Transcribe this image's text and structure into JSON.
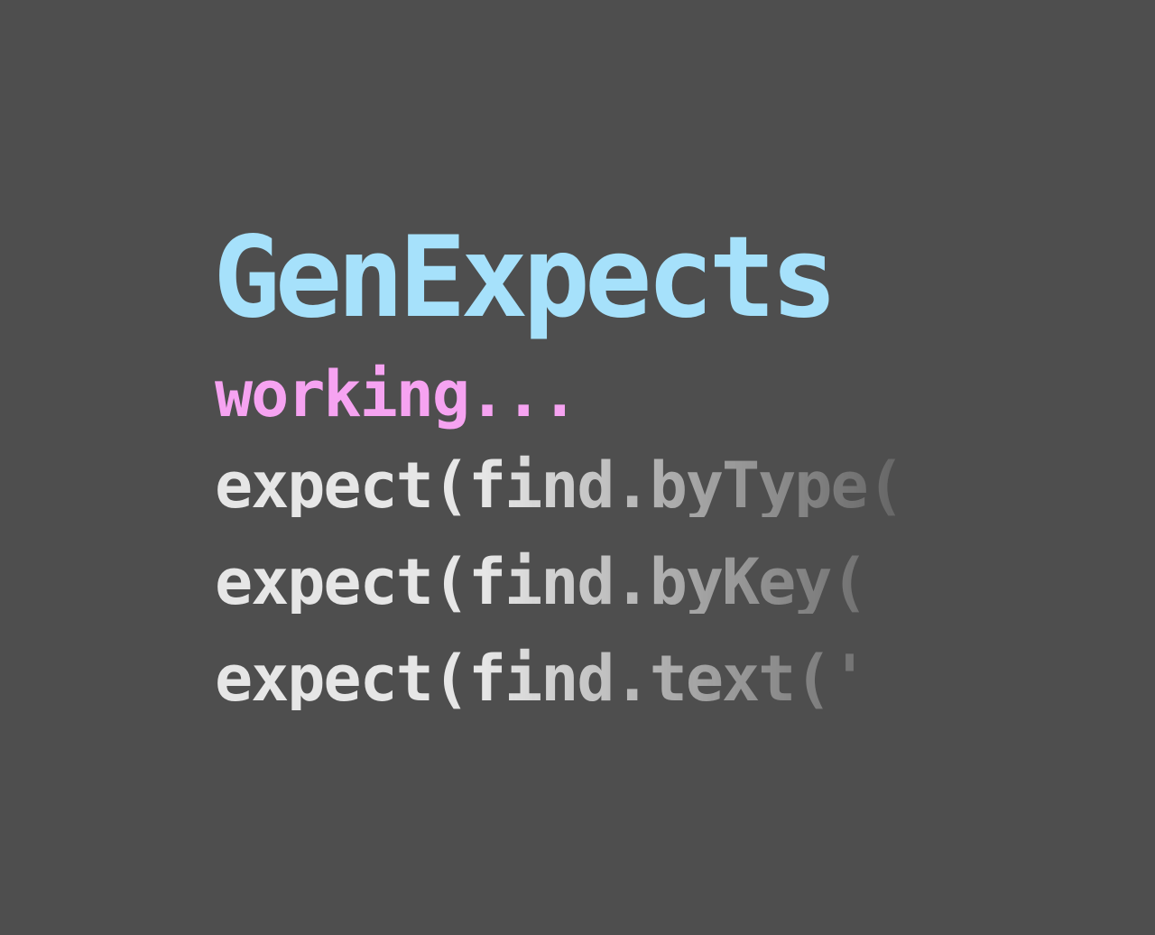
{
  "title": "GenExpects",
  "status": "working...",
  "code_lines": [
    "expect(find.byType(",
    "expect(find.byKey(",
    "expect(find.text('"
  ],
  "colors": {
    "background": "#4e4e4e",
    "title": "#a6e1fb",
    "status": "#f6a3f1",
    "code": "#e6e6e6"
  }
}
